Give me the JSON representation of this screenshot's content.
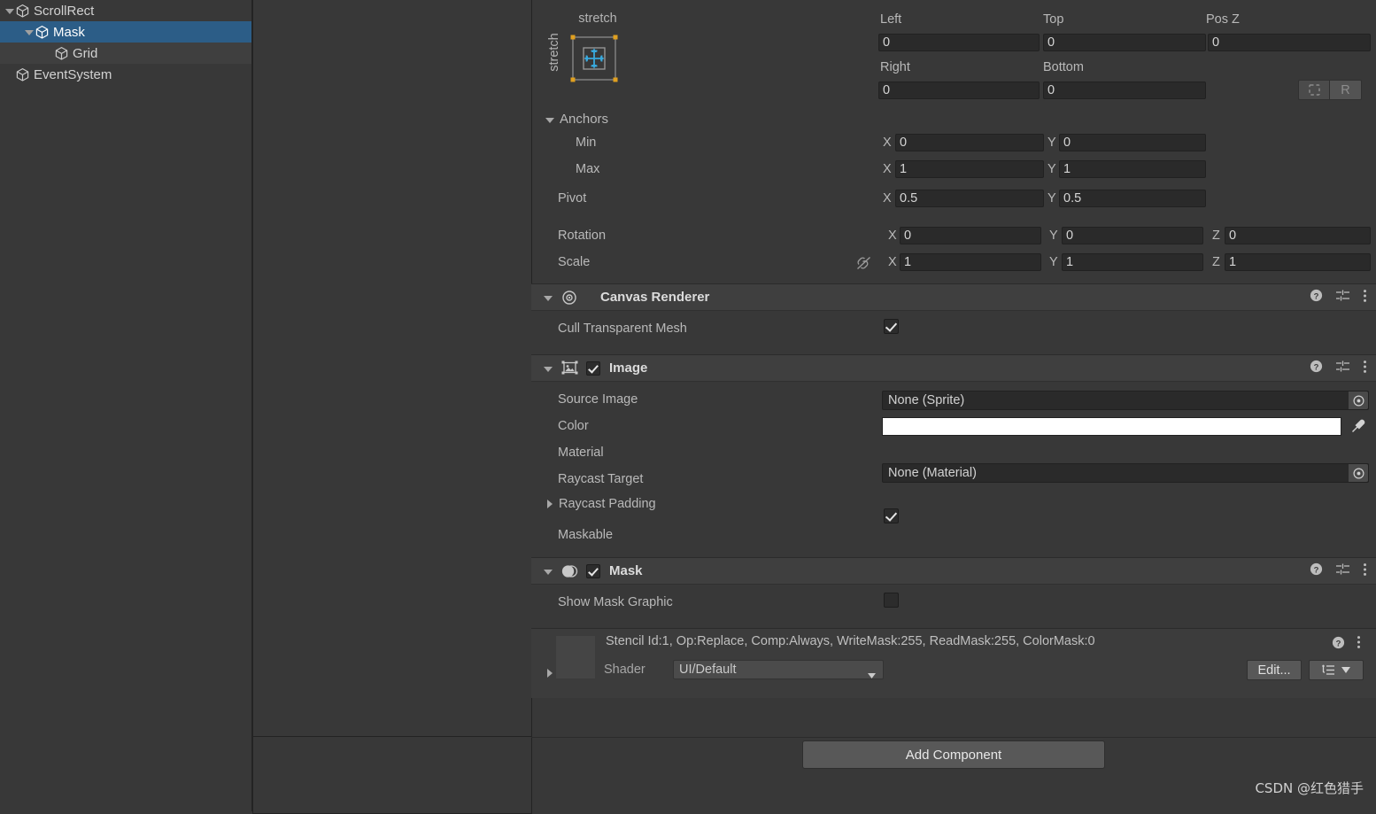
{
  "hierarchy": {
    "items": [
      {
        "label": "ScrollRect",
        "depth": 0,
        "foldout": "open",
        "selected": false,
        "alt": false
      },
      {
        "label": "Mask",
        "depth": 1,
        "foldout": "open",
        "selected": true,
        "alt": false
      },
      {
        "label": "Grid",
        "depth": 2,
        "foldout": "none",
        "selected": false,
        "alt": true
      },
      {
        "label": "EventSystem",
        "depth": 0,
        "foldout": "none",
        "selected": false,
        "alt": false
      }
    ]
  },
  "inspector": {
    "rect_transform": {
      "anchor_preset": {
        "top_label": "stretch",
        "left_label": "stretch"
      },
      "left": {
        "label": "Left",
        "value": "0"
      },
      "top": {
        "label": "Top",
        "value": "0"
      },
      "pos_z": {
        "label": "Pos Z",
        "value": "0"
      },
      "right": {
        "label": "Right",
        "value": "0"
      },
      "bottom": {
        "label": "Bottom",
        "value": "0"
      },
      "blueprint_button": "blueprint-mode",
      "raw_button": "R",
      "anchors_label": "Anchors",
      "min": {
        "label": "Min",
        "x_label": "X",
        "x": "0",
        "y_label": "Y",
        "y": "0"
      },
      "max": {
        "label": "Max",
        "x_label": "X",
        "x": "1",
        "y_label": "Y",
        "y": "1"
      },
      "pivot": {
        "label": "Pivot",
        "x_label": "X",
        "x": "0.5",
        "y_label": "Y",
        "y": "0.5"
      },
      "rotation": {
        "label": "Rotation",
        "x_label": "X",
        "x": "0",
        "y_label": "Y",
        "y": "0",
        "z_label": "Z",
        "z": "0"
      },
      "scale": {
        "label": "Scale",
        "x_label": "X",
        "x": "1",
        "y_label": "Y",
        "y": "1",
        "z_label": "Z",
        "z": "1"
      }
    },
    "canvas_renderer": {
      "title": "Canvas Renderer",
      "cull_transparent_mesh": {
        "label": "Cull Transparent Mesh",
        "checked": true
      }
    },
    "image": {
      "title": "Image",
      "enabled": true,
      "source_image": {
        "label": "Source Image",
        "value": "None (Sprite)"
      },
      "color": {
        "label": "Color",
        "value": "#FFFFFF"
      },
      "material": {
        "label": "Material",
        "value": "None (Material)"
      },
      "raycast_target": {
        "label": "Raycast Target",
        "checked": true
      },
      "raycast_padding": {
        "label": "Raycast Padding",
        "expanded": false
      },
      "maskable": {
        "label": "Maskable",
        "checked": true
      }
    },
    "mask": {
      "title": "Mask",
      "enabled": true,
      "show_mask_graphic": {
        "label": "Show Mask Graphic",
        "checked": false
      }
    },
    "material_preview": {
      "stencil_info": "Stencil Id:1, Op:Replace, Comp:Always, WriteMask:255, ReadMask:255, ColorMask:0",
      "shader_label": "Shader",
      "shader_value": "UI/Default",
      "edit_button": "Edit..."
    },
    "add_component_button": "Add Component"
  },
  "watermark": "CSDN @红色猎手",
  "colors": {
    "panel_bg": "#383838",
    "header_bg": "#3f3f3f",
    "selection_blue": "#2c5d87",
    "field_bg": "#2a2a2a",
    "anchor_handle": "#e0a020",
    "anchor_arrow": "#39a9dd"
  }
}
